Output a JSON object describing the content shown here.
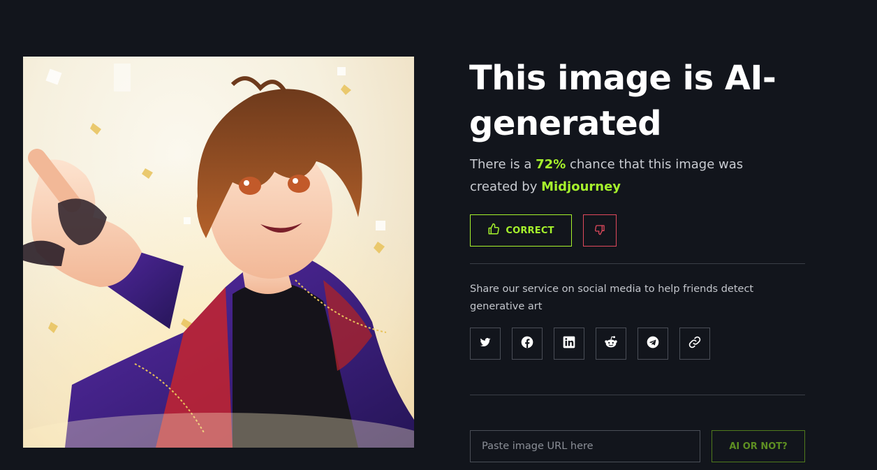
{
  "result": {
    "title": "This image is AI-generated",
    "desc_prefix": "There is a ",
    "probability": "72%",
    "desc_middle": " chance that this image was created by ",
    "generator": "Midjourney"
  },
  "feedback": {
    "correct_label": "CORRECT",
    "correct_icon": "thumbs-up-icon",
    "incorrect_icon": "thumbs-down-icon"
  },
  "share": {
    "text": "Share our service on social media to help friends detect generative art",
    "networks": [
      {
        "name": "Twitter",
        "icon": "twitter-icon"
      },
      {
        "name": "Facebook",
        "icon": "facebook-icon"
      },
      {
        "name": "LinkedIn",
        "icon": "linkedin-icon"
      },
      {
        "name": "Reddit",
        "icon": "reddit-icon"
      },
      {
        "name": "Telegram",
        "icon": "telegram-icon"
      },
      {
        "name": "Copy link",
        "icon": "link-icon"
      }
    ]
  },
  "check": {
    "placeholder": "Paste image URL here",
    "value": "",
    "button_label": "AI OR NOT?"
  },
  "colors": {
    "background": "#12151c",
    "accent": "#a6f22c",
    "danger": "#e0495c",
    "border": "#4a4e57"
  }
}
